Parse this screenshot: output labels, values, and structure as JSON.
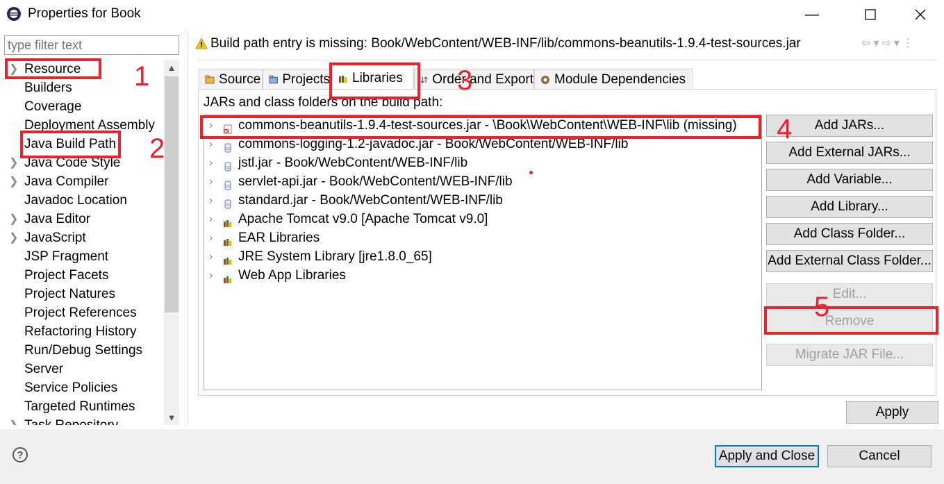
{
  "window": {
    "title": "Properties for Book"
  },
  "filter": {
    "placeholder": "type filter text"
  },
  "nav": {
    "items": [
      {
        "label": "Resource",
        "expandable": true
      },
      {
        "label": "Builders",
        "expandable": false
      },
      {
        "label": "Coverage",
        "expandable": false
      },
      {
        "label": "Deployment Assembly",
        "expandable": false
      },
      {
        "label": "Java Build Path",
        "expandable": false,
        "selected": true
      },
      {
        "label": "Java Code Style",
        "expandable": true
      },
      {
        "label": "Java Compiler",
        "expandable": true
      },
      {
        "label": "Javadoc Location",
        "expandable": false
      },
      {
        "label": "Java Editor",
        "expandable": true
      },
      {
        "label": "JavaScript",
        "expandable": true
      },
      {
        "label": "JSP Fragment",
        "expandable": false
      },
      {
        "label": "Project Facets",
        "expandable": false
      },
      {
        "label": "Project Natures",
        "expandable": false
      },
      {
        "label": "Project References",
        "expandable": false
      },
      {
        "label": "Refactoring History",
        "expandable": false
      },
      {
        "label": "Run/Debug Settings",
        "expandable": false
      },
      {
        "label": "Server",
        "expandable": false
      },
      {
        "label": "Service Policies",
        "expandable": false
      },
      {
        "label": "Targeted Runtimes",
        "expandable": false
      },
      {
        "label": "Task Repository",
        "expandable": true
      }
    ]
  },
  "header": {
    "message": "Build path entry is missing: Book/WebContent/WEB-INF/lib/commons-beanutils-1.9.4-test-sources.jar"
  },
  "tabs": [
    {
      "label": "Source",
      "icon": "source-icon"
    },
    {
      "label": "Projects",
      "icon": "projects-icon"
    },
    {
      "label": "Libraries",
      "icon": "libraries-icon",
      "active": true
    },
    {
      "label": "Order and Export",
      "icon": "order-icon"
    },
    {
      "label": "Module Dependencies",
      "icon": "module-icon"
    }
  ],
  "libraries": {
    "caption": "JARs and class folders on the build path:",
    "rows": [
      {
        "text": "commons-beanutils-1.9.4-test-sources.jar - \\Book\\WebContent\\WEB-INF\\lib (missing)",
        "icon": "missing-jar-icon"
      },
      {
        "text": "commons-logging-1.2-javadoc.jar - Book/WebContent/WEB-INF/lib",
        "icon": "jar-icon"
      },
      {
        "text": "jstl.jar - Book/WebContent/WEB-INF/lib",
        "icon": "jar-icon"
      },
      {
        "text": "servlet-api.jar - Book/WebContent/WEB-INF/lib",
        "icon": "jar-icon"
      },
      {
        "text": "standard.jar - Book/WebContent/WEB-INF/lib",
        "icon": "jar-icon"
      },
      {
        "text": "Apache Tomcat v9.0 [Apache Tomcat v9.0]",
        "icon": "library-icon"
      },
      {
        "text": "EAR Libraries",
        "icon": "library-icon"
      },
      {
        "text": "JRE System Library [jre1.8.0_65]",
        "icon": "library-icon"
      },
      {
        "text": "Web App Libraries",
        "icon": "library-icon"
      }
    ]
  },
  "buttons": {
    "add_jars": "Add JARs...",
    "add_external_jars": "Add External JARs...",
    "add_variable": "Add Variable...",
    "add_library": "Add Library...",
    "add_class_folder": "Add Class Folder...",
    "add_external_class_folder": "Add External Class Folder...",
    "edit": "Edit...",
    "remove": "Remove",
    "migrate": "Migrate JAR File...",
    "apply": "Apply",
    "apply_and_close": "Apply and Close",
    "cancel": "Cancel"
  },
  "annotations": [
    "1",
    "2",
    "3",
    "4",
    "5"
  ],
  "colors": {
    "annotation": "#e8232d",
    "default_button_border": "#0078d7"
  }
}
